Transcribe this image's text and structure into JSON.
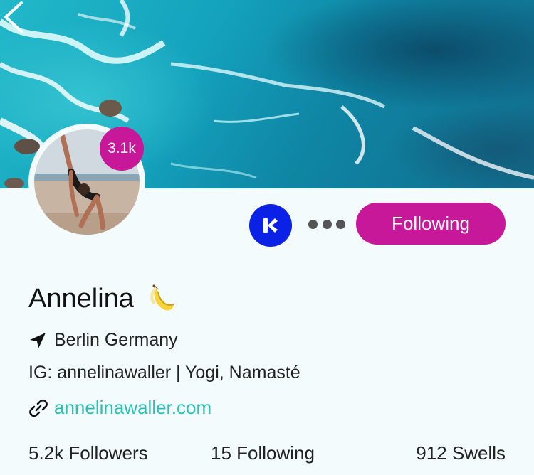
{
  "profile": {
    "follower_badge": "3.1k",
    "name": "Annelina",
    "name_emoji": "banana-emoji",
    "location": "Berlin Germany",
    "bio": "IG: annelinawaller | Yogi, Namasté",
    "website": "annelinawaller.com"
  },
  "actions": {
    "follow_label": "Following",
    "more_icon": "more-dots-icon",
    "app_icon": "k-logo-icon"
  },
  "stats": {
    "followers": "5.2k Followers",
    "following": "15 Following",
    "swells": "912 Swells"
  },
  "colors": {
    "accent": "#c8189a",
    "k_button": "#0b22e6",
    "link": "#2cbfb4",
    "background": "#f3fbfc"
  }
}
